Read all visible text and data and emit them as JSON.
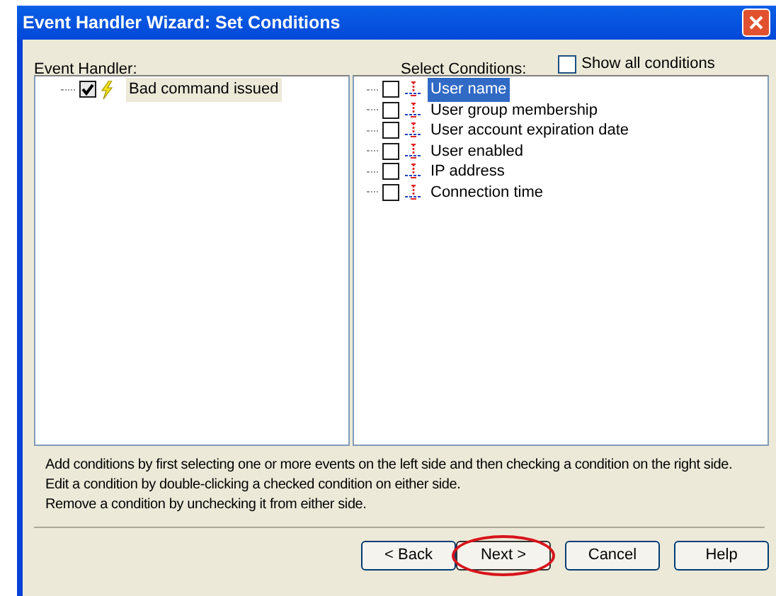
{
  "window": {
    "title": "Event Handler Wizard: Set Conditions"
  },
  "event_handler": {
    "label": "Event Handler:",
    "items": [
      {
        "label": "Bad command issued",
        "checked": true,
        "selected": true
      }
    ]
  },
  "conditions": {
    "label": "Select Conditions:",
    "show_all": {
      "label": "Show all conditions",
      "checked": false
    },
    "items": [
      {
        "label": "User name",
        "checked": false,
        "selected": true
      },
      {
        "label": "User group membership",
        "checked": false,
        "selected": false
      },
      {
        "label": "User account expiration date",
        "checked": false,
        "selected": false
      },
      {
        "label": "User enabled",
        "checked": false,
        "selected": false
      },
      {
        "label": "IP address",
        "checked": false,
        "selected": false
      },
      {
        "label": "Connection time",
        "checked": false,
        "selected": false
      }
    ]
  },
  "help_lines": [
    "Add conditions by first selecting one or more events on the left side and then checking a condition on the right side.",
    "Edit a condition by double-clicking a checked condition on either side.",
    "Remove a condition by unchecking it from either side."
  ],
  "buttons": [
    {
      "label": "< Back",
      "highlighted": false
    },
    {
      "label": "Next >",
      "highlighted": true
    },
    {
      "label": "Cancel",
      "highlighted": false
    },
    {
      "label": "Help",
      "highlighted": false
    }
  ]
}
